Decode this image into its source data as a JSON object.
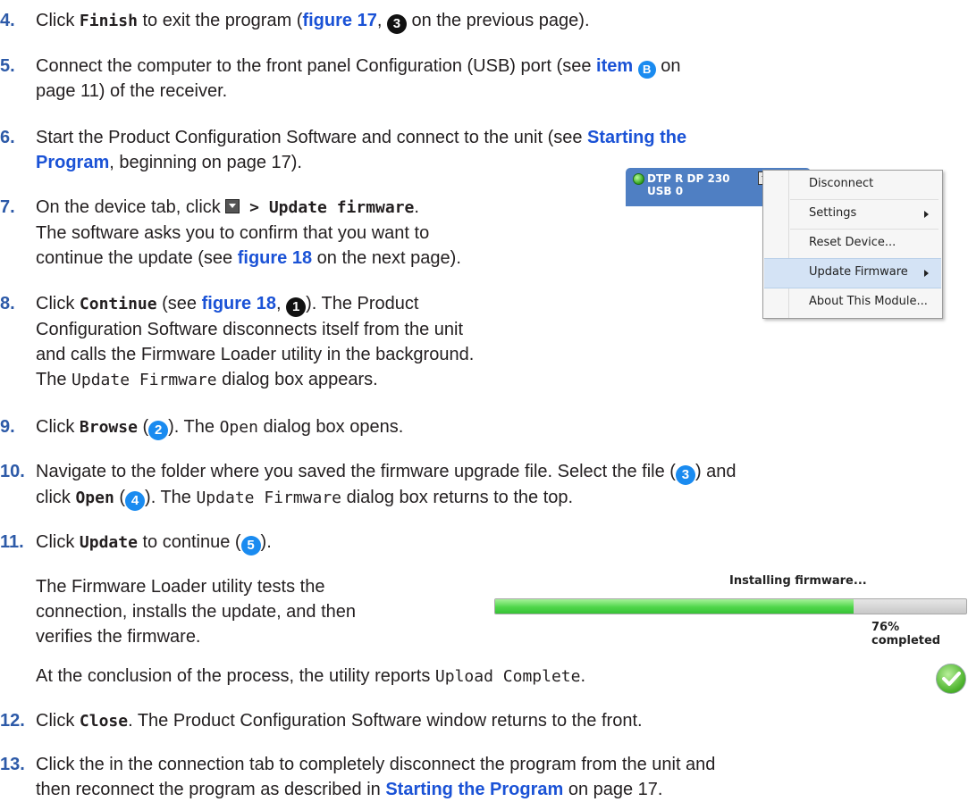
{
  "steps": {
    "s4": {
      "num": "4.",
      "a": "Click ",
      "b": "Finish",
      "c": " to exit the program (",
      "d": "figure 17",
      "e": ", ",
      "f": "3",
      "g": " on the previous page)."
    },
    "s5": {
      "num": "5.",
      "a": "Connect the computer to the front panel Configuration (USB) port (see ",
      "b": "item",
      "c": "B",
      "d": " on",
      "e": "page 11) of the receiver."
    },
    "s6": {
      "num": "6.",
      "a": "Start the Product Configuration Software and connect to the unit (see ",
      "b": "Starting the",
      "c": "Program",
      "d": ", beginning on page 17)."
    },
    "s7": {
      "num": "7.",
      "a": "On the device tab, click ",
      "b": " > Update firmware",
      "c": ".",
      "d": "The software asks you to confirm that you want to",
      "e": "continue the update (see ",
      "f": "figure 18",
      "g": " on the next page)."
    },
    "s8": {
      "num": "8.",
      "a": "Click ",
      "b": "Continue",
      "c": " (see ",
      "d": "figure 18",
      "e": ", ",
      "f": "1",
      "g": "). The Product",
      "h": "Configuration Software disconnects itself from the unit",
      "i": "and calls the Firmware Loader utility in the background.",
      "j": "The ",
      "k": "Update Firmware",
      "l": " dialog box appears."
    },
    "s9": {
      "num": "9.",
      "a": "Click ",
      "b": "Browse",
      "c": " (",
      "d": "2",
      "e": "). The ",
      "f": "Open",
      "g": " dialog box opens."
    },
    "s10": {
      "num": "10.",
      "a": "Navigate to the folder where you saved the firmware upgrade file. Select the file (",
      "b": "3",
      "c": ") and",
      "d": "click ",
      "e": "Open",
      "f": " (",
      "g": "4",
      "h": "). The ",
      "i": "Update Firmware",
      "j": " dialog box returns to the top."
    },
    "s11": {
      "num": "11.",
      "a": "Click ",
      "b": "Update",
      "c": " to continue (",
      "d": "5",
      "e": ").",
      "f": "The Firmware Loader utility tests the",
      "g": "connection, installs the update, and then",
      "h": "verifies the firmware.",
      "i": "At the conclusion of the process, the utility reports ",
      "j": "Upload Complete",
      "k": "."
    },
    "s12": {
      "num": "12.",
      "a": "Click ",
      "b": "Close",
      "c": ". The Product Configuration Software window returns to the front."
    },
    "s13": {
      "num": "13.",
      "a": "Click the in the connection tab to completely disconnect the program from the unit and",
      "b": "then reconnect the program as described in ",
      "c": "Starting the Program",
      "d": " on page 17."
    }
  },
  "device_tab": {
    "name": "DTP R DP 230",
    "port": "USB 0"
  },
  "context_menu": {
    "items": [
      {
        "label": "Disconnect",
        "submenu": false
      },
      {
        "label": "Settings",
        "submenu": true
      },
      {
        "label": "Reset Device...",
        "submenu": false
      },
      {
        "label": "Update Firmware",
        "submenu": true,
        "highlighted": true
      },
      {
        "label": "About This Module...",
        "submenu": false
      }
    ]
  },
  "progress": {
    "title": "Installing firmware...",
    "status": "76% completed",
    "fraction": 0.76
  },
  "colors": {
    "step_number": "#2d5aa8",
    "link": "#1a52d6",
    "menu_highlight": "#d4e3f5",
    "progress_fill": "#4fd64a",
    "tab": "#4f7fc3"
  },
  "icons": {
    "success": "green-checkmark-icon",
    "dropdown": "dropdown-arrow-icon",
    "status_led": "green-led-icon"
  }
}
